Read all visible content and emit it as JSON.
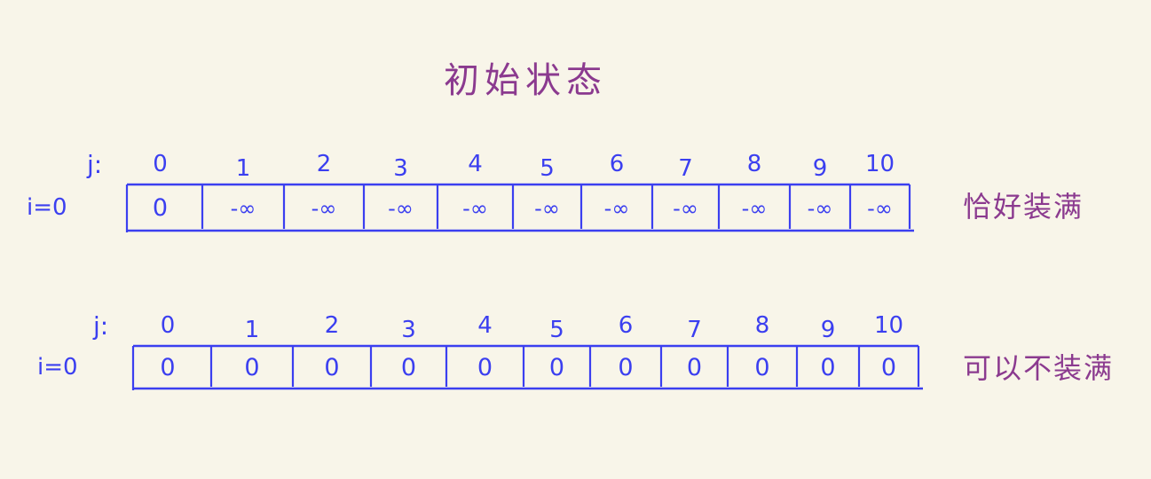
{
  "title": "初始状态",
  "colors": {
    "ink_blue": "#3b3ff0",
    "ink_purple": "#8b3a8f",
    "background": "#f8f5e9"
  },
  "tables": [
    {
      "row_label": "i=0",
      "col_prefix": "j:",
      "columns": [
        "0",
        "1",
        "2",
        "3",
        "4",
        "5",
        "6",
        "7",
        "8",
        "9",
        "10"
      ],
      "values": [
        "0",
        "-∞",
        "-∞",
        "-∞",
        "-∞",
        "-∞",
        "-∞",
        "-∞",
        "-∞",
        "-∞",
        "-∞"
      ],
      "side_label": "恰好装满"
    },
    {
      "row_label": "i=0",
      "col_prefix": "j:",
      "columns": [
        "0",
        "1",
        "2",
        "3",
        "4",
        "5",
        "6",
        "7",
        "8",
        "9",
        "10"
      ],
      "values": [
        "0",
        "0",
        "0",
        "0",
        "0",
        "0",
        "0",
        "0",
        "0",
        "0",
        "0"
      ],
      "side_label": "可以不装满"
    }
  ]
}
